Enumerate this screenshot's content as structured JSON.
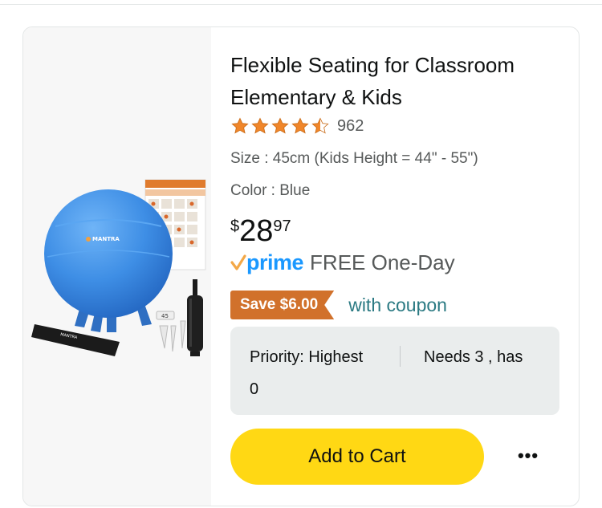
{
  "product": {
    "title": "Flexible Seating for Classroom Elementary & Kids",
    "rating": 4.5,
    "rating_icon": "star-rating-icon",
    "review_count": "962",
    "size_text": "Size : 45cm (Kids Height = 44\" - 55\")",
    "color_text": "Color : Blue",
    "price": {
      "currency": "$",
      "whole": "28",
      "fraction": "97"
    },
    "prime": {
      "logo_text": "prime",
      "delivery": "FREE One-Day",
      "check_color": "#f3a847",
      "logo_color": "#1a98ff"
    },
    "coupon": {
      "badge": "Save $6.00",
      "text": "with coupon",
      "badge_color": "#d1712b",
      "text_color": "#2b7a83"
    },
    "image": {
      "brand": "MANTRA",
      "pump_label": "45",
      "ball_color": "#3e8ee5"
    }
  },
  "list_meta": {
    "priority": "Priority: Highest",
    "needs_line1": "Needs 3 , has",
    "needs_line2": "0"
  },
  "actions": {
    "add_to_cart": "Add to Cart",
    "more": "•••",
    "add_to_cart_color": "#ffd814"
  }
}
